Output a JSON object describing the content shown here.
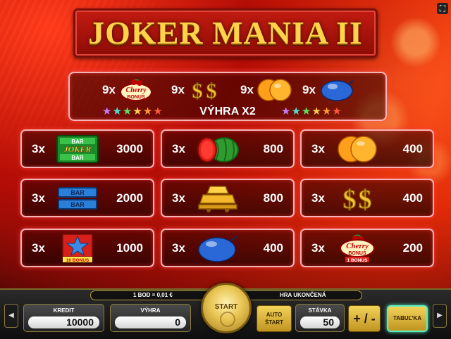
{
  "title": "JOKER MANIA II",
  "bonus_row": {
    "items": [
      {
        "count": "9x",
        "symbol": "cherry-bonus"
      },
      {
        "count": "9x",
        "symbol": "dollar"
      },
      {
        "count": "9x",
        "symbol": "orange"
      },
      {
        "count": "9x",
        "symbol": "plum"
      }
    ],
    "win_label": "VÝHRA X2",
    "star_colors": [
      "#c77dff",
      "#4de0d0",
      "#5fe05f",
      "#ffd24a",
      "#ff9a3a",
      "#ff5a3a"
    ]
  },
  "paytable": [
    {
      "count": "3x",
      "symbol": "joker-bar",
      "payout": "3000",
      "icon_text": [
        "BAR",
        "JOKER",
        "BAR"
      ]
    },
    {
      "count": "3x",
      "symbol": "watermelon",
      "payout": "800"
    },
    {
      "count": "3x",
      "symbol": "orange",
      "payout": "400"
    },
    {
      "count": "3x",
      "symbol": "double-bar",
      "payout": "2000",
      "icon_text": [
        "BAR",
        "BAR"
      ]
    },
    {
      "count": "3x",
      "symbol": "gold-bars",
      "payout": "800"
    },
    {
      "count": "3x",
      "symbol": "dollar",
      "payout": "400"
    },
    {
      "count": "3x",
      "symbol": "star",
      "payout": "1000",
      "icon_text": [
        "10 BONUS"
      ]
    },
    {
      "count": "3x",
      "symbol": "plum",
      "payout": "400"
    },
    {
      "count": "3x",
      "symbol": "cherry-bonus",
      "payout": "200",
      "icon_text": [
        "1 BONUS"
      ]
    }
  ],
  "info_strip": {
    "rate": "1 BOD = 0,01 €",
    "status": "HRA UKONČENÁ"
  },
  "controls": {
    "credit_label": "KREDIT",
    "credit_value": "10000",
    "win_label": "VÝHRA",
    "win_value": "0",
    "start_label": "START",
    "auto_start_line1": "AUTO",
    "auto_start_line2": "ŠTART",
    "bet_label": "STÁVKA",
    "bet_value": "50",
    "plus_minus": "+ / -",
    "table_label": "TABUĽ'KA",
    "fullscreen_icon": "fullscreen-icon",
    "sound_icon": "speaker-icon",
    "menu_icon": "menu-icon"
  }
}
